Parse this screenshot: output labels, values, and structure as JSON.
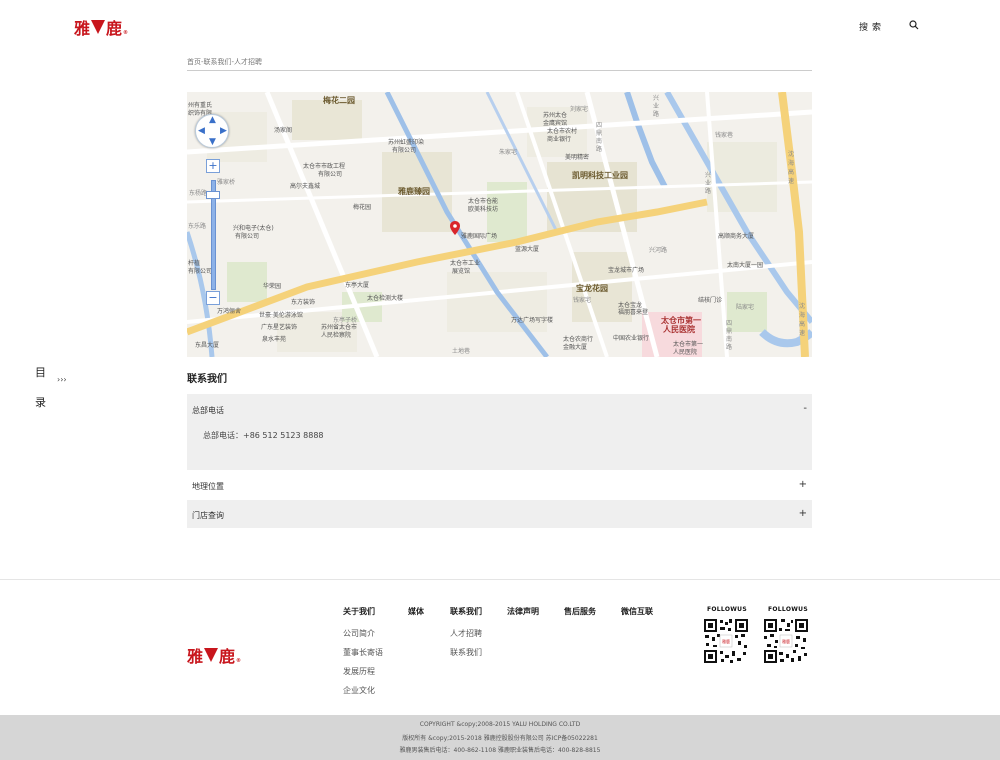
{
  "header": {
    "logo_left": "雅",
    "logo_right": "鹿",
    "logo_mark": "®",
    "search_label": "搜索"
  },
  "breadcrumb": "首页-联系我们-人才招聘",
  "map": {
    "labels": {
      "l1": "梅花二园",
      "l2": "州有重氏",
      "l3": "织饰有限",
      "l4": "汤家阁",
      "l5": "苏州虹盛印染",
      "l6": "有限公司",
      "l7": "苏州太仓",
      "l8": "金鹰宾馆",
      "l9": "太仓市农村",
      "l10": "商业银行",
      "l11": "刘家宅",
      "l12": "美明精密",
      "l13": "朱家宅",
      "l14": "凯明科技工业园",
      "l15": "太仓市市政工程",
      "l16": "有限公司",
      "l17": "高尔夫鑫城",
      "l18": "雅鹿臻园",
      "l19": "太仓市仓能",
      "l20": "欧美科技坊",
      "l21": "梅花园",
      "l22": "兴和电子(太仓)",
      "l23": "有限公司",
      "l24": "雅鹿国际广场",
      "l25": "蓝源大厦",
      "l26": "太仓市工业",
      "l27": "展览馆",
      "l28": "宝龙城市广场",
      "l29": "宝龙花园",
      "l30": "钱家宅",
      "l31": "太仓宝龙",
      "l32": "福朋喜来登",
      "l33": "华荣园",
      "l34": "东亭大厦",
      "l35": "东方装饰",
      "l36": "太仓检测大楼",
      "l37": "世豪·美伦游泳馆",
      "l38": "东亭子桥",
      "l39": "广东星艺装饰",
      "l40": "苏州省太仓市",
      "l41": "人民检察院",
      "l42": "泉水丰苑",
      "l43": "万达广场写字楼",
      "l44": "太仓农商行",
      "l45": "金融大厦",
      "l46": "中国农业银行",
      "l47": "太仓市第一",
      "l48": "人民医院",
      "l49": "太仓市第一",
      "l50": "人民医院",
      "l51": "东昌大厦",
      "l52": "万鸿俪舍",
      "l53": "土地巷",
      "l54": "高顺商务大厦",
      "l55": "太南大厦一园",
      "l56": "结核门诊",
      "l57": "陆家宅",
      "l58": "沈海高速",
      "l59": "沈海高速",
      "l60": "四鼎南路",
      "l61": "四鼎南路",
      "l62": "兴业路",
      "l63": "兴业路",
      "l64": "东杨路",
      "l65": "雅家桥",
      "l66": "钱家巷",
      "l67": "杆植",
      "l68": "有限公司",
      "l69": "兴河路",
      "l70": "东乐路"
    },
    "controls": {
      "zoom_in": "+",
      "zoom_out": "−"
    }
  },
  "side_nav": {
    "label_1": "目",
    "label_2": "录",
    "arrow": "›››"
  },
  "contact": {
    "title": "联系我们",
    "sections": [
      {
        "label": "总部电话",
        "sign": "-",
        "body": "总部电话：+86 512 5123 8888"
      },
      {
        "label": "地理位置",
        "sign": "+"
      },
      {
        "label": "门店查询",
        "sign": "+"
      }
    ]
  },
  "footer": {
    "columns": [
      {
        "head": "关于我们",
        "items": [
          "公司简介",
          "董事长寄语",
          "发展历程",
          "企业文化"
        ]
      },
      {
        "head": "媒体",
        "items": []
      },
      {
        "head": "联系我们",
        "items": [
          "人才招聘",
          "联系我们"
        ]
      },
      {
        "head": "法律声明",
        "items": []
      },
      {
        "head": "售后服务",
        "items": []
      },
      {
        "head": "微信互联",
        "items": []
      }
    ],
    "follow_1": "FOLLOWUS",
    "follow_2": "FOLLOWUS",
    "qr_center": "雅鹿",
    "copyright": [
      "COPYRIGHT &copy;2008-2015 YALU HOLDING CO.LTD",
      "版权所有 &copy;2015-2018 雅鹿控股股份有限公司 苏ICP备05022281",
      "雅鹿男装售后电话：400-862-1108    雅鹿职业装售后电话：400-828-8815"
    ]
  },
  "colors": {
    "brand_red": "#c8161d",
    "map_road_blue": "#9ec0e8",
    "map_road_yellow": "#f5d27a",
    "accordion_bg": "#efefef"
  }
}
